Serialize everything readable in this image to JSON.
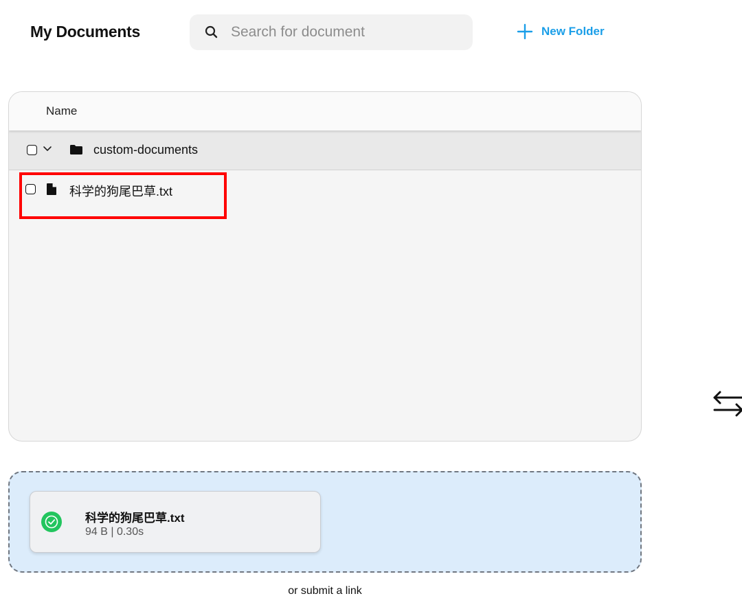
{
  "header": {
    "title": "My Documents",
    "search_placeholder": "Search for document",
    "search_value": "",
    "new_folder_label": "New Folder",
    "accent_color": "#1a9ee8"
  },
  "table": {
    "column_name": "Name",
    "folder": {
      "name": "custom-documents",
      "expanded": true,
      "checked": false,
      "icon": "folder-icon",
      "files": [
        {
          "name": "科学的狗尾巴草.txt",
          "checked": false,
          "icon": "file-icon",
          "highlighted": true
        }
      ]
    }
  },
  "upload": {
    "file_name": "科学的狗尾巴草.txt",
    "meta": "94 B | 0.30s",
    "status": "success",
    "status_color": "#22c55e",
    "submit_link_text": "or submit a link"
  },
  "side": {
    "icon": "swap-arrows-icon"
  }
}
